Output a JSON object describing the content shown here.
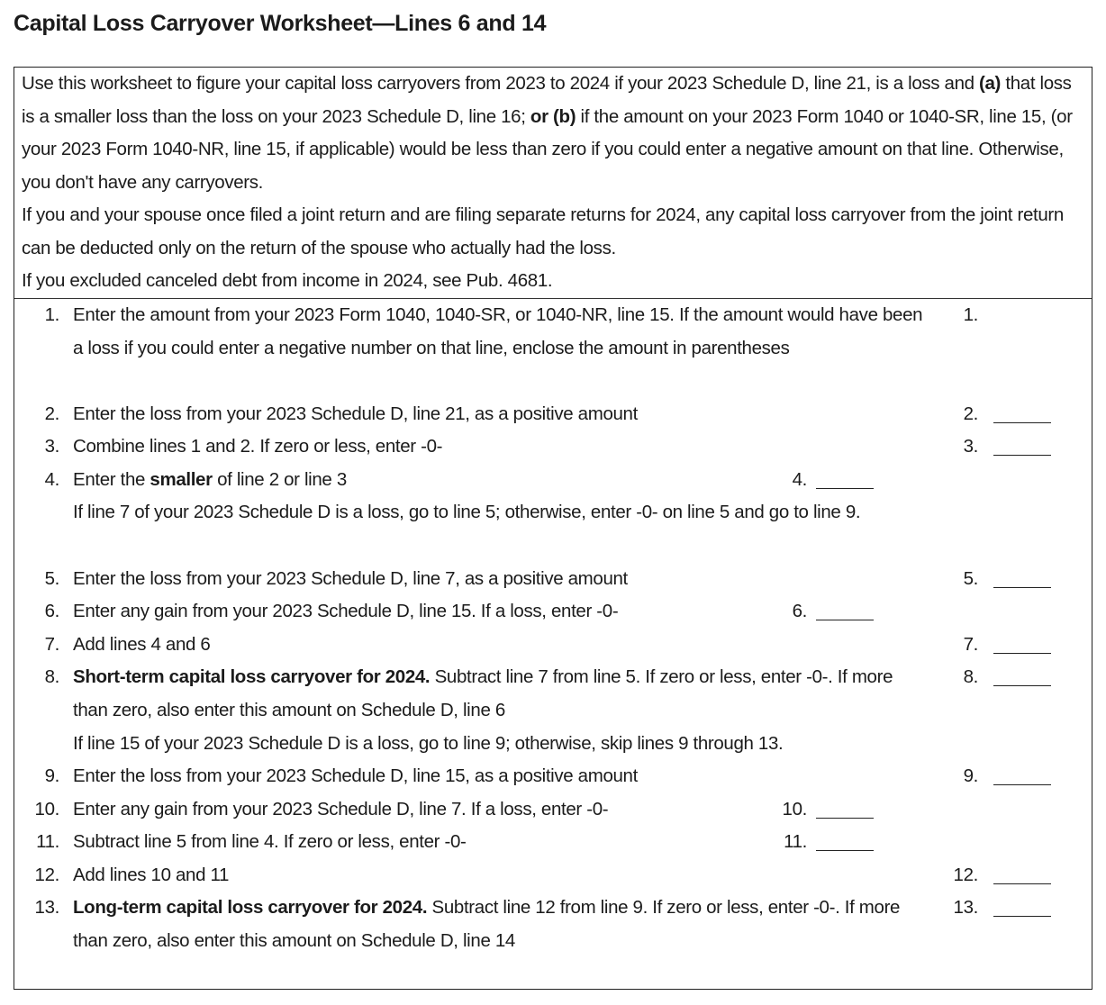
{
  "title": "Capital Loss Carryover Worksheet—Lines 6 and 14",
  "intro": {
    "p1_part1": "Use this worksheet to figure your capital loss carryovers from 2023 to 2024 if your 2023 Schedule D, line 21, is a loss and ",
    "p1_bold_a": "(a)",
    "p1_part2": " that loss is a smaller loss than the loss on your 2023 Schedule D, line 16; ",
    "p1_bold_or_b": "or (b)",
    "p1_part3": " if the amount on your 2023 Form 1040 or 1040-SR, line 15, (or your 2023 Form 1040-NR, line 15, if applicable) would be less than zero if you could enter a negative amount on that line. Otherwise, you don't have any carryovers.",
    "p2": "If you and your spouse once filed a joint return and are filing separate returns for 2024, any capital loss carryover from the joint return can be deducted only on the return of the spouse who actually had the loss.",
    "p3": "If you excluded canceled debt from income in 2024, see Pub. 4681."
  },
  "lines": [
    {
      "num": "1.",
      "text": "Enter the amount from your 2023 Form 1040, 1040-SR, or 1040-NR, line 15. If the amount would have been a loss if you could enter a negative number on that line, enclose the amount in parentheses",
      "ref": "1.",
      "column": "right",
      "has_blank": false
    },
    {
      "num": "2.",
      "text": "Enter the loss from your 2023 Schedule D, line 21, as a positive amount",
      "ref": "2.",
      "column": "right",
      "has_blank": true
    },
    {
      "num": "3.",
      "text": "Combine lines 1 and 2. If zero or less, enter -0-",
      "ref": "3.",
      "column": "right",
      "has_blank": true
    },
    {
      "num": "4.",
      "text_pre": "Enter the ",
      "text_bold": "smaller",
      "text_post": " of line 2 or line 3",
      "ref": "4.",
      "column": "mid",
      "has_blank": true
    },
    {
      "num": "",
      "text": "If line 7 of your 2023 Schedule D is a loss, go to line 5; otherwise, enter -0- on line 5 and go to line 9."
    },
    {
      "num": "5.",
      "text": "Enter the loss from your 2023 Schedule D, line 7, as a positive amount",
      "ref": "5.",
      "column": "right",
      "has_blank": true
    },
    {
      "num": "6.",
      "text": "Enter any gain from your 2023 Schedule D, line 15. If a loss, enter -0-",
      "ref": "6.",
      "column": "mid",
      "has_blank": true
    },
    {
      "num": "7.",
      "text": "Add lines 4 and 6",
      "ref": "7.",
      "column": "right",
      "has_blank": true
    },
    {
      "num": "8.",
      "text_bold": "Short-term capital loss carryover for 2024.",
      "text_post": " Subtract line 7 from line 5. If zero or less, enter -0-. If more than zero, also enter this amount on Schedule D, line 6",
      "ref": "8.",
      "column": "right",
      "has_blank": true
    },
    {
      "num": "",
      "text": "If line 15 of your 2023 Schedule D is a loss, go to line 9; otherwise, skip lines 9 through 13."
    },
    {
      "num": "9.",
      "text": "Enter the loss from your 2023 Schedule D, line 15, as a positive amount",
      "ref": "9.",
      "column": "right",
      "has_blank": true
    },
    {
      "num": "10.",
      "text": "Enter any gain from your 2023 Schedule D, line 7. If a loss, enter -0-",
      "ref": "10.",
      "column": "mid",
      "has_blank": true
    },
    {
      "num": "11.",
      "text": "Subtract line 5 from line 4. If zero or less, enter -0-",
      "ref": "11.",
      "column": "mid",
      "has_blank": true
    },
    {
      "num": "12.",
      "text": "Add lines 10 and 11",
      "ref": "12.",
      "column": "right",
      "has_blank": true
    },
    {
      "num": "13.",
      "text_bold": "Long-term capital loss carryover for 2024.",
      "text_post": " Subtract line 12 from line 9. If zero or less, enter -0-. If more than zero, also enter this amount on Schedule D, line 14",
      "ref": "13.",
      "column": "right",
      "has_blank": true
    }
  ]
}
